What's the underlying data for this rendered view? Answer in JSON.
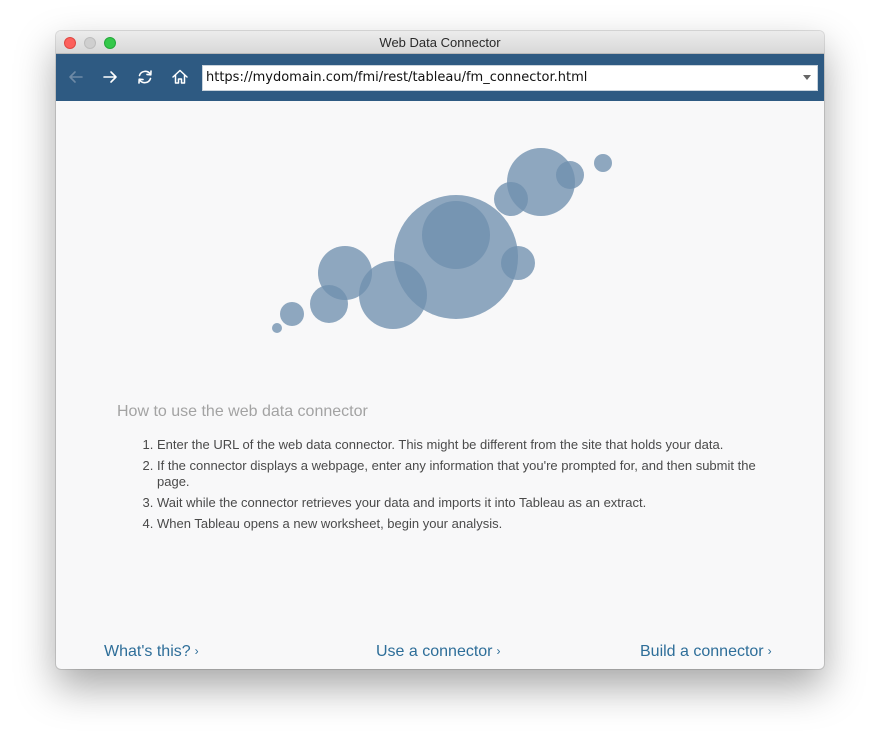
{
  "window": {
    "title": "Web Data Connector"
  },
  "toolbar": {
    "url": "https://mydomain.com/fmi/rest/tableau/fm_connector.html",
    "icons": [
      "back-arrow-icon",
      "forward-arrow-icon",
      "refresh-icon",
      "home-icon",
      "chevron-down-icon"
    ]
  },
  "content": {
    "heading": "How to use the web data connector",
    "steps": [
      "Enter the URL of the web data connector. This might be different from the site that holds your data.",
      "If the connector displays a webpage, enter any information that you're prompted for, and then submit the page.",
      "Wait while the connector retrieves your data and imports it into Tableau as an extract.",
      "When Tableau opens a new worksheet, begin your analysis."
    ]
  },
  "links": {
    "whats_this": "What's this?",
    "use_connector": "Use a connector",
    "build_connector": "Build a connector",
    "chevron": "›"
  },
  "colors": {
    "toolbar": "#2e5a82",
    "bubble": "#6f8fae",
    "link": "#2e6e99"
  }
}
